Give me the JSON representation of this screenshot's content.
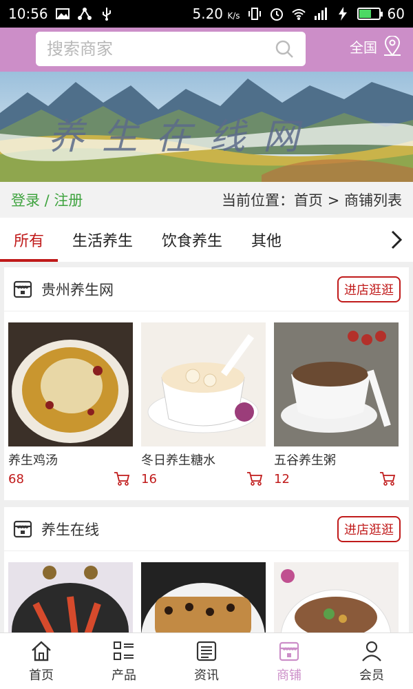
{
  "status": {
    "time": "10:56",
    "speed": "5.20",
    "speed_unit": "K/s",
    "battery": "60",
    "battery_level": 0.6
  },
  "header": {
    "search_placeholder": "搜索商家",
    "region_label": "全国"
  },
  "banner": {
    "title": "养生在线网"
  },
  "breadcrumb": {
    "login": "登录 / 注册",
    "location": "当前位置：首页 > 商铺列表"
  },
  "tabs": [
    {
      "label": "所有",
      "active": true
    },
    {
      "label": "生活养生"
    },
    {
      "label": "饮食养生"
    },
    {
      "label": "其他"
    }
  ],
  "stores": [
    {
      "name": "贵州养生网",
      "enter_label": "进店逛逛",
      "products": [
        {
          "name": "养生鸡汤",
          "price": "68"
        },
        {
          "name": "冬日养生糖水",
          "price": "16"
        },
        {
          "name": "五谷养生粥",
          "price": "12"
        }
      ]
    },
    {
      "name": "养生在线",
      "enter_label": "进店逛逛",
      "products": [
        {
          "name": ""
        },
        {
          "name": ""
        },
        {
          "name": ""
        }
      ]
    }
  ],
  "bottom_nav": [
    {
      "label": "首页",
      "icon": "home-icon"
    },
    {
      "label": "产品",
      "icon": "grid-list-icon"
    },
    {
      "label": "资讯",
      "icon": "news-icon"
    },
    {
      "label": "商铺",
      "icon": "store-icon",
      "active": true
    },
    {
      "label": "会员",
      "icon": "user-icon"
    }
  ],
  "colors": {
    "brand": "#cc8ec8",
    "accent": "#c01a1a",
    "login": "#3fa33f"
  }
}
